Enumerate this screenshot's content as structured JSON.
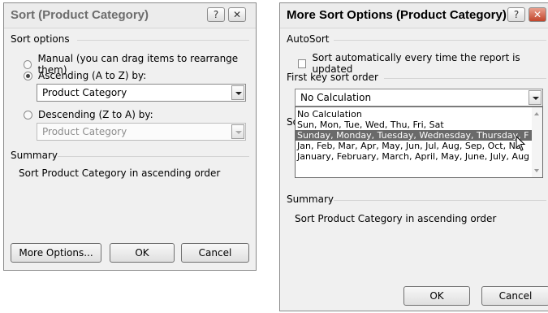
{
  "left_dialog": {
    "title": "Sort (Product Category)",
    "help_btn": "?",
    "close_btn": "✕",
    "sort_options_label": "Sort options",
    "manual_label": "Manual (you can drag items to rearrange them)",
    "ascending_label": "Ascending (A to Z) by:",
    "ascending_value": "Product Category",
    "descending_label": "Descending (Z to A) by:",
    "descending_value": "Product Category",
    "summary_label": "Summary",
    "summary_text": "Sort Product Category in ascending order",
    "more_options": "More Options...",
    "ok": "OK",
    "cancel": "Cancel"
  },
  "right_dialog": {
    "title": "More Sort Options (Product Category)",
    "help_btn": "?",
    "close_btn": "✕",
    "autosort_label": "AutoSort",
    "autosort_check_label": "Sort automatically every time the report is updated",
    "first_key_label": "First key sort order",
    "first_key_value": "No Calculation",
    "list_items": [
      "No Calculation",
      "Sun, Mon, Tue, Wed, Thu, Fri, Sat",
      "Sunday, Monday, Tuesday, Wednesday, Thursday, F",
      "Jan, Feb, Mar, Apr, May, Jun, Jul, Aug, Sep, Oct, No",
      "January, February, March, April, May, June, July, Aug"
    ],
    "hidden_prefix": "So",
    "summary_label": "Summary",
    "summary_text": "Sort Product Category in ascending order",
    "ok": "OK",
    "cancel": "Cancel"
  }
}
